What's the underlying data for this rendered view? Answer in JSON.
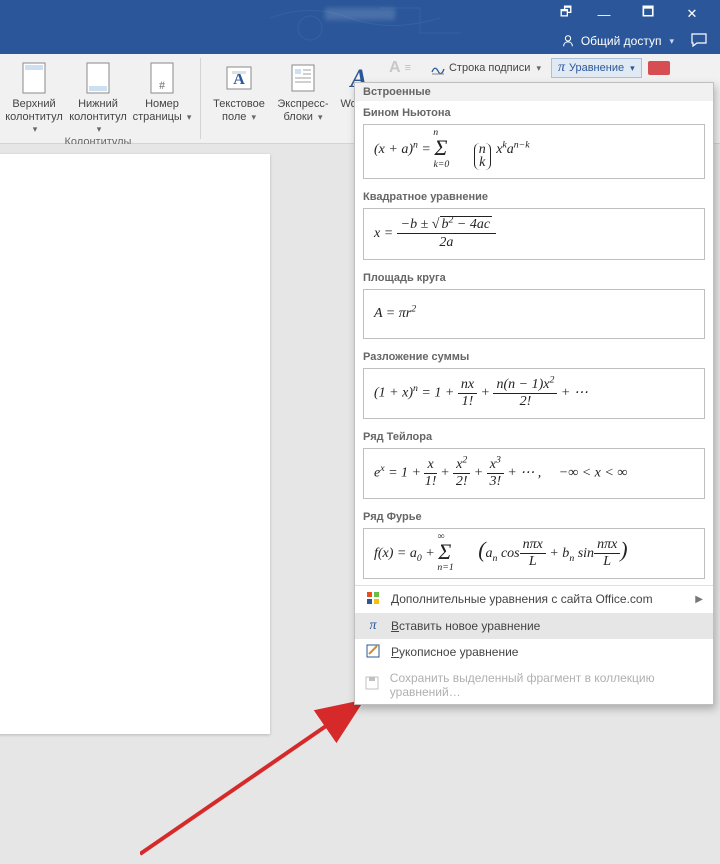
{
  "titlebar": {
    "restoredown": "🗗",
    "minimize": "—",
    "maximize": "🗖",
    "close": "✕"
  },
  "sharebar": {
    "share_label": "Общий доступ"
  },
  "ribbon": {
    "header": {
      "label": "Верхний",
      "sub": "колонтитул"
    },
    "footer": {
      "label": "Нижний",
      "sub": "колонтитул"
    },
    "pageno": {
      "label": "Номер",
      "sub": "страницы"
    },
    "group1_label": "Колонтитулы",
    "textbox": {
      "label": "Текстовое",
      "sub": "поле"
    },
    "quickparts": {
      "label": "Экспресс-",
      "sub": "блоки"
    },
    "wordart": {
      "label": "WordAr"
    },
    "dropcap": {
      "glyph": "A"
    },
    "signline": "Строка подписи",
    "equation": "Уравнение"
  },
  "dropdown": {
    "builtin_header": "Встроенные",
    "eq1_label": "Бином Ньютона",
    "eq1_html": "(x + a)<sup>n</sup> = <span style='font-size:22px;position:relative;top:2px'>Σ</span><sub style='position:relative;left:-14px;top:10px'>k=0</sub><sup style='position:relative;left:-30px;top:-12px'>n</sup> <span style='display:inline-flex;flex-direction:column;align-items:center;border-left:1px solid #222;border-right:1px solid #222;border-radius:6px;padding:0 4px;line-height:.95;font-style:italic;margin:0 2px'><span>n</span><span>k</span></span> x<sup>k</sup>a<sup>n−k</sup>",
    "eq2_label": "Квадратное уравнение",
    "eq2_html": "x = <span style='display:inline-block;vertical-align:middle;text-align:center'><span style='display:block;border-bottom:1px solid #222;padding:0 4px'>−b ± √<span style='border-top:1px solid #222;padding:0 2px'>b<sup>2</sup> − 4ac</span></span><span style='display:block;padding-top:1px'>2a</span></span>",
    "eq3_label": "Площадь круга",
    "eq3_html": "A = πr<sup>2</sup>",
    "eq4_label": "Разложение суммы",
    "eq4_html": "(1 + x)<sup>n</sup> = 1 + <span style='display:inline-block;vertical-align:middle;text-align:center'><span style='display:block;border-bottom:1px solid #222;padding:0 3px'>nx</span><span>1!</span></span> + <span style='display:inline-block;vertical-align:middle;text-align:center'><span style='display:block;border-bottom:1px solid #222;padding:0 3px'>n(n − 1)x<sup>2</sup></span><span>2!</span></span> + ⋯",
    "eq5_label": "Ряд Тейлора",
    "eq5_html": "e<sup>x</sup> = 1 + <span style='display:inline-block;vertical-align:middle;text-align:center'><span style='display:block;border-bottom:1px solid #222;padding:0 3px'>x</span><span>1!</span></span> + <span style='display:inline-block;vertical-align:middle;text-align:center'><span style='display:block;border-bottom:1px solid #222;padding:0 3px'>x<sup>2</sup></span><span>2!</span></span> + <span style='display:inline-block;vertical-align:middle;text-align:center'><span style='display:block;border-bottom:1px solid #222;padding:0 3px'>x<sup>3</sup></span><span>3!</span></span> + ⋯ , &nbsp;&nbsp;&nbsp; −∞ &lt; x &lt; ∞",
    "eq6_label": "Ряд Фурье",
    "eq6_html": "f(x) = a<sub>0</sub> + <span style='font-size:22px;position:relative;top:2px'>Σ</span><sub style='position:relative;left:-14px;top:10px'>n=1</sub><sup style='position:relative;left:-30px;top:-12px'>∞</sup> <span style='font-size:22px'>(</span>a<sub>n</sub> cos<span style='display:inline-block;vertical-align:middle;text-align:center'><span style='display:block;border-bottom:1px solid #222;padding:0 3px'>nπx</span><span>L</span></span> + b<sub>n</sub> sin<span style='display:inline-block;vertical-align:middle;text-align:center'><span style='display:block;border-bottom:1px solid #222;padding:0 3px'>nπx</span><span>L</span></span><span style='font-size:22px'>)</span>",
    "menu": {
      "more": "Дополнительные уравнения с сайта Office.com",
      "insert": "Вставить новое уравнение",
      "ink": "Рукописное уравнение",
      "save": "Сохранить выделенный фрагмент в коллекцию уравнений…"
    }
  }
}
